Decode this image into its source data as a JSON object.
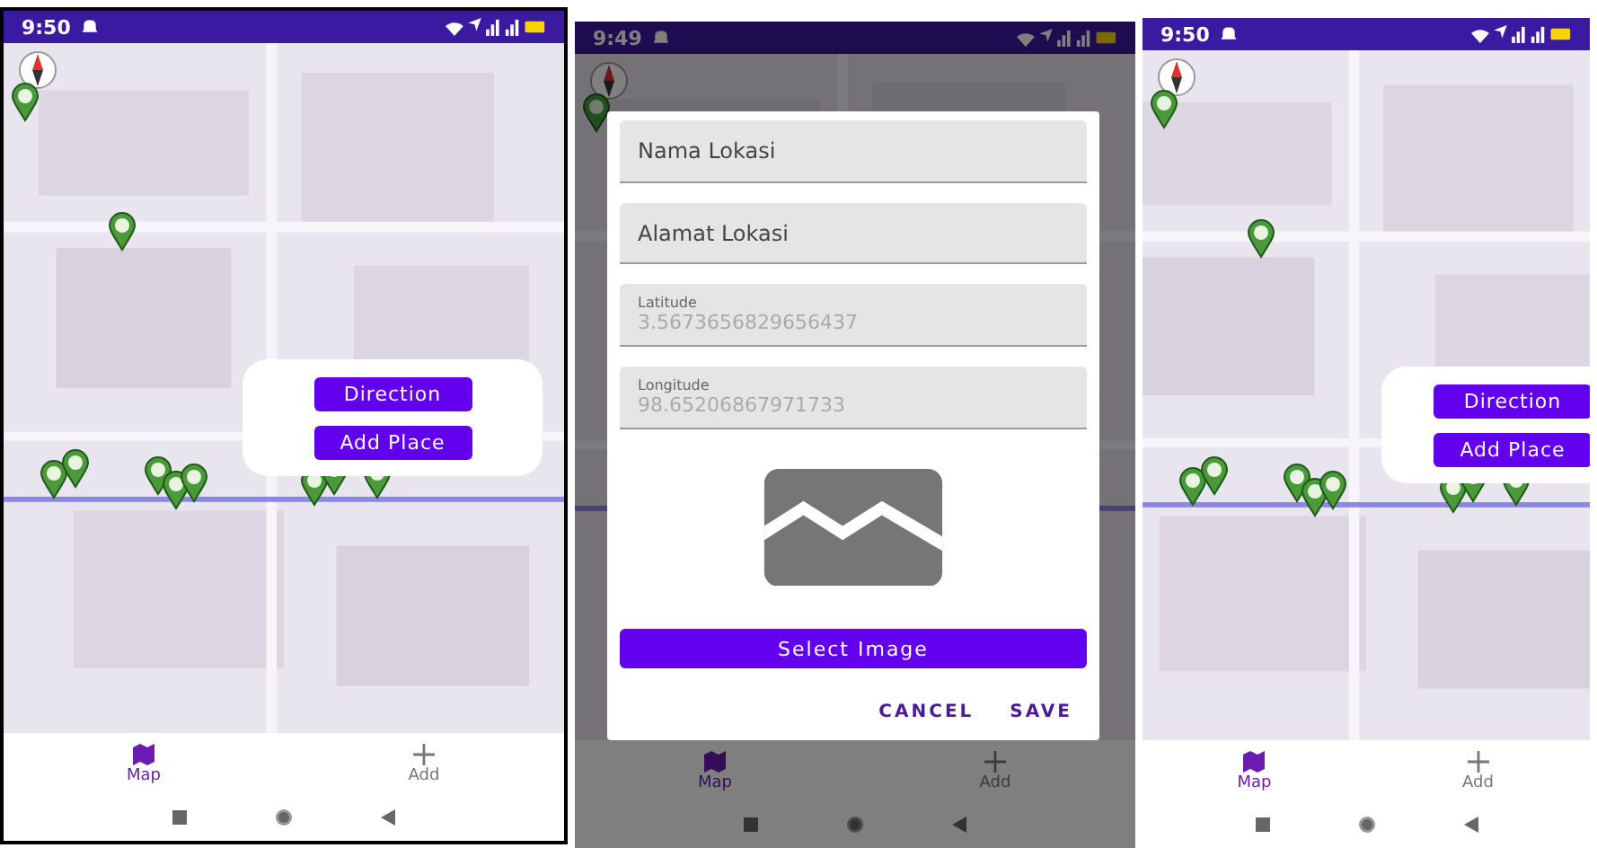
{
  "screens": [
    {
      "status_bar": {
        "time": "9:50"
      },
      "dimmed": false,
      "overlay": {
        "kind": "popup",
        "buttons": [
          "Direction",
          "Add Place"
        ]
      },
      "bottom_nav": [
        {
          "label": "Map",
          "selected": true
        },
        {
          "label": "Add",
          "selected": false
        }
      ]
    },
    {
      "status_bar": {
        "time": "9:49"
      },
      "dimmed": true,
      "overlay": {
        "kind": "dialog",
        "fields": [
          {
            "kind": "text",
            "placeholder": "Nama Lokasi"
          },
          {
            "kind": "text",
            "placeholder": "Alamat Lokasi"
          },
          {
            "kind": "readonly",
            "label": "Latitude",
            "value": "3.5673656829656437"
          },
          {
            "kind": "readonly",
            "label": "Longitude",
            "value": "98.65206867971733"
          }
        ],
        "select_button": "Select Image",
        "actions": [
          "CANCEL",
          "SAVE"
        ]
      },
      "bottom_nav": [
        {
          "label": "Map",
          "selected": true
        },
        {
          "label": "Add",
          "selected": false
        }
      ]
    },
    {
      "status_bar": {
        "time": "9:50"
      },
      "dimmed": false,
      "overlay": {
        "kind": "popup",
        "buttons": [
          "Direction",
          "Add Place"
        ]
      },
      "bottom_nav": [
        {
          "label": "Map",
          "selected": true
        },
        {
          "label": "Add",
          "selected": false
        }
      ]
    }
  ]
}
